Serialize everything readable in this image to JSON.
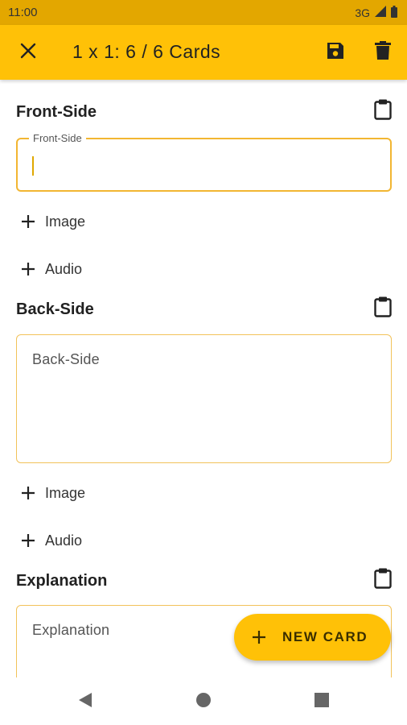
{
  "status_bar": {
    "time": "11:00",
    "network": "3G"
  },
  "app_bar": {
    "title": "1 x 1: 6 / 6 Cards"
  },
  "front": {
    "title": "Front-Side",
    "field_label": "Front-Side",
    "add_image": "Image",
    "add_audio": "Audio"
  },
  "back": {
    "title": "Back-Side",
    "placeholder": "Back-Side",
    "add_image": "Image",
    "add_audio": "Audio"
  },
  "explanation": {
    "title": "Explanation",
    "placeholder": "Explanation"
  },
  "fab": {
    "label": "NEW CARD"
  },
  "icons": {
    "close": "close-icon",
    "save": "save-icon",
    "delete": "delete-icon",
    "clipboard": "clipboard-icon",
    "plus": "plus-icon",
    "back": "nav-back-icon",
    "home": "nav-home-icon",
    "recents": "nav-recents-icon"
  },
  "colors": {
    "primary": "#FFC107",
    "status_bar": "#E3A700",
    "field_border": "#F2C25A"
  }
}
